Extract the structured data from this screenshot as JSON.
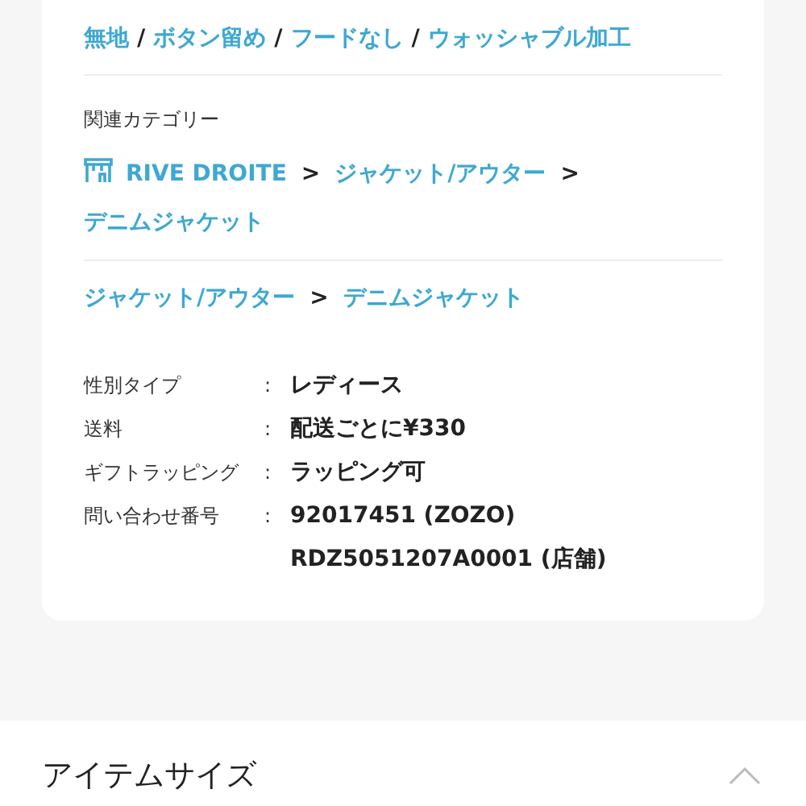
{
  "tags": [
    {
      "label": "無地"
    },
    {
      "separator": "/",
      "label": "ボタン留め"
    },
    {
      "separator": "/",
      "label": "フードなし"
    },
    {
      "separator": "/",
      "label": "ウォッシャブル加工"
    }
  ],
  "related_categories": {
    "heading": "関連カテゴリー",
    "breadcrumbs": [
      [
        {
          "kind": "shop",
          "label": "RIVE DROITE"
        },
        {
          "separator": ">",
          "label": "ジャケット/アウター"
        },
        {
          "separator": ">",
          "label": "デニムジャケット"
        }
      ],
      [
        {
          "label": "ジャケット/アウター"
        },
        {
          "separator": ">",
          "label": "デニムジャケット"
        }
      ]
    ]
  },
  "specs": [
    {
      "label": "性別タイプ",
      "colon": ":",
      "values": [
        "レディース"
      ]
    },
    {
      "label": "送料",
      "colon": ":",
      "values": [
        "配送ごとに¥330"
      ]
    },
    {
      "label": "ギフトラッピング",
      "colon": ":",
      "values": [
        "ラッピング可"
      ]
    },
    {
      "label": "問い合わせ番号",
      "colon": ":",
      "values": [
        "92017451 (ZOZO)",
        "RDZ5051207A0001 (店舗)"
      ]
    }
  ],
  "item_size": {
    "heading": "アイテムサイズ",
    "expanded": true
  }
}
